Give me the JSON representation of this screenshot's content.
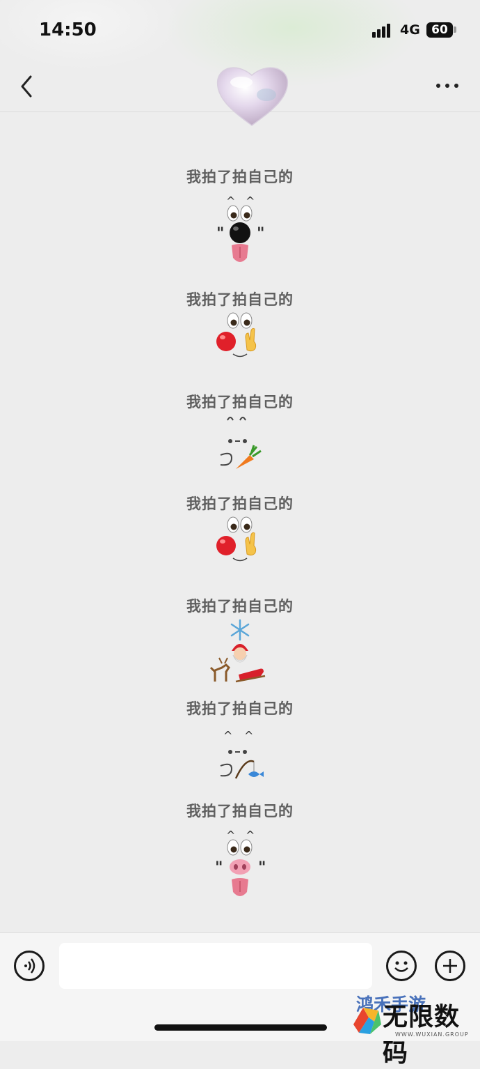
{
  "status": {
    "time": "14:50",
    "network": "4G",
    "battery": "60"
  },
  "nav": {
    "back_icon": "chevron-left-icon",
    "avatar_icon": "heart-icon",
    "more_icon": "more-dots-icon"
  },
  "posts": [
    {
      "text": "我拍了拍自己的",
      "art": "dog-face"
    },
    {
      "text": "我拍了拍自己的",
      "art": "clown-peace"
    },
    {
      "text": "我拍了拍自己的",
      "art": "bunny-carrot"
    },
    {
      "text": "我拍了拍自己的",
      "art": "clown-peace"
    },
    {
      "text": "我拍了拍自己的",
      "art": "santa-sleigh"
    },
    {
      "text": "我拍了拍自己的",
      "art": "bunny-fishing"
    },
    {
      "text": "我拍了拍自己的",
      "art": "pig-face"
    }
  ],
  "chat_bar": {
    "voice_icon": "voice-icon",
    "input_value": "",
    "emoji_icon": "emoji-icon",
    "plus_icon": "plus-icon"
  },
  "watermark": {
    "top_text": "鸿禾手游",
    "main_text": "无限数码",
    "sub_text": "WWW.WUXIAN.GROUP"
  }
}
